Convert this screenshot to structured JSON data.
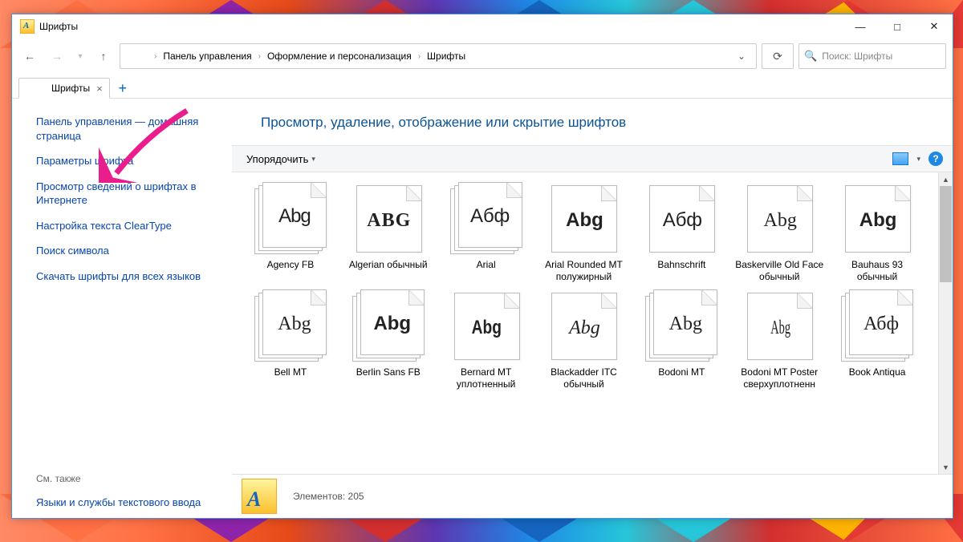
{
  "window": {
    "title": "Шрифты"
  },
  "breadcrumb": {
    "items": [
      "Панель управления",
      "Оформление и персонализация",
      "Шрифты"
    ]
  },
  "search": {
    "placeholder": "Поиск: Шрифты"
  },
  "tab": {
    "label": "Шрифты"
  },
  "sidebar": {
    "items": [
      "Панель управления — домашняя страница",
      "Параметры шрифта",
      "Просмотр сведений о шрифтах в Интернете",
      "Настройка текста ClearType",
      "Поиск символа",
      "Скачать шрифты для всех языков"
    ],
    "also_label": "См. также",
    "also": [
      "Языки и службы текстового ввода"
    ]
  },
  "heading": "Просмотр, удаление, отображение или скрытие шрифтов",
  "toolbar": {
    "organize": "Упорядочить"
  },
  "fonts": [
    {
      "name": "Agency FB",
      "sample": "Abg",
      "cls": "f-agency",
      "stack": true
    },
    {
      "name": "Algerian обычный",
      "sample": "ABG",
      "cls": "f-algerian",
      "stack": false
    },
    {
      "name": "Arial",
      "sample": "Абф",
      "cls": "f-arial",
      "stack": true
    },
    {
      "name": "Arial Rounded MT полужирный",
      "sample": "Abg",
      "cls": "f-arialrnd",
      "stack": false
    },
    {
      "name": "Bahnschrift",
      "sample": "Абф",
      "cls": "f-bahn",
      "stack": false
    },
    {
      "name": "Baskerville Old Face обычный",
      "sample": "Abg",
      "cls": "f-basker",
      "stack": false
    },
    {
      "name": "Bauhaus 93 обычный",
      "sample": "Abg",
      "cls": "f-bauhaus",
      "stack": false
    },
    {
      "name": "Bell MT",
      "sample": "Abg",
      "cls": "f-bell",
      "stack": true
    },
    {
      "name": "Berlin Sans FB",
      "sample": "Abg",
      "cls": "f-berlin",
      "stack": true
    },
    {
      "name": "Bernard MT уплотненный",
      "sample": "Abg",
      "cls": "f-bernard",
      "stack": false
    },
    {
      "name": "Blackadder ITC обычный",
      "sample": "Abg",
      "cls": "f-blackadder",
      "stack": false
    },
    {
      "name": "Bodoni MT",
      "sample": "Abg",
      "cls": "f-bodoni",
      "stack": true
    },
    {
      "name": "Bodoni MT Poster сверхуплотненн",
      "sample": "Abg",
      "cls": "f-bodonip",
      "stack": false
    },
    {
      "name": "Book Antiqua",
      "sample": "Абф",
      "cls": "f-book",
      "stack": true
    }
  ],
  "status": {
    "count_label": "Элементов:",
    "count": "205"
  }
}
